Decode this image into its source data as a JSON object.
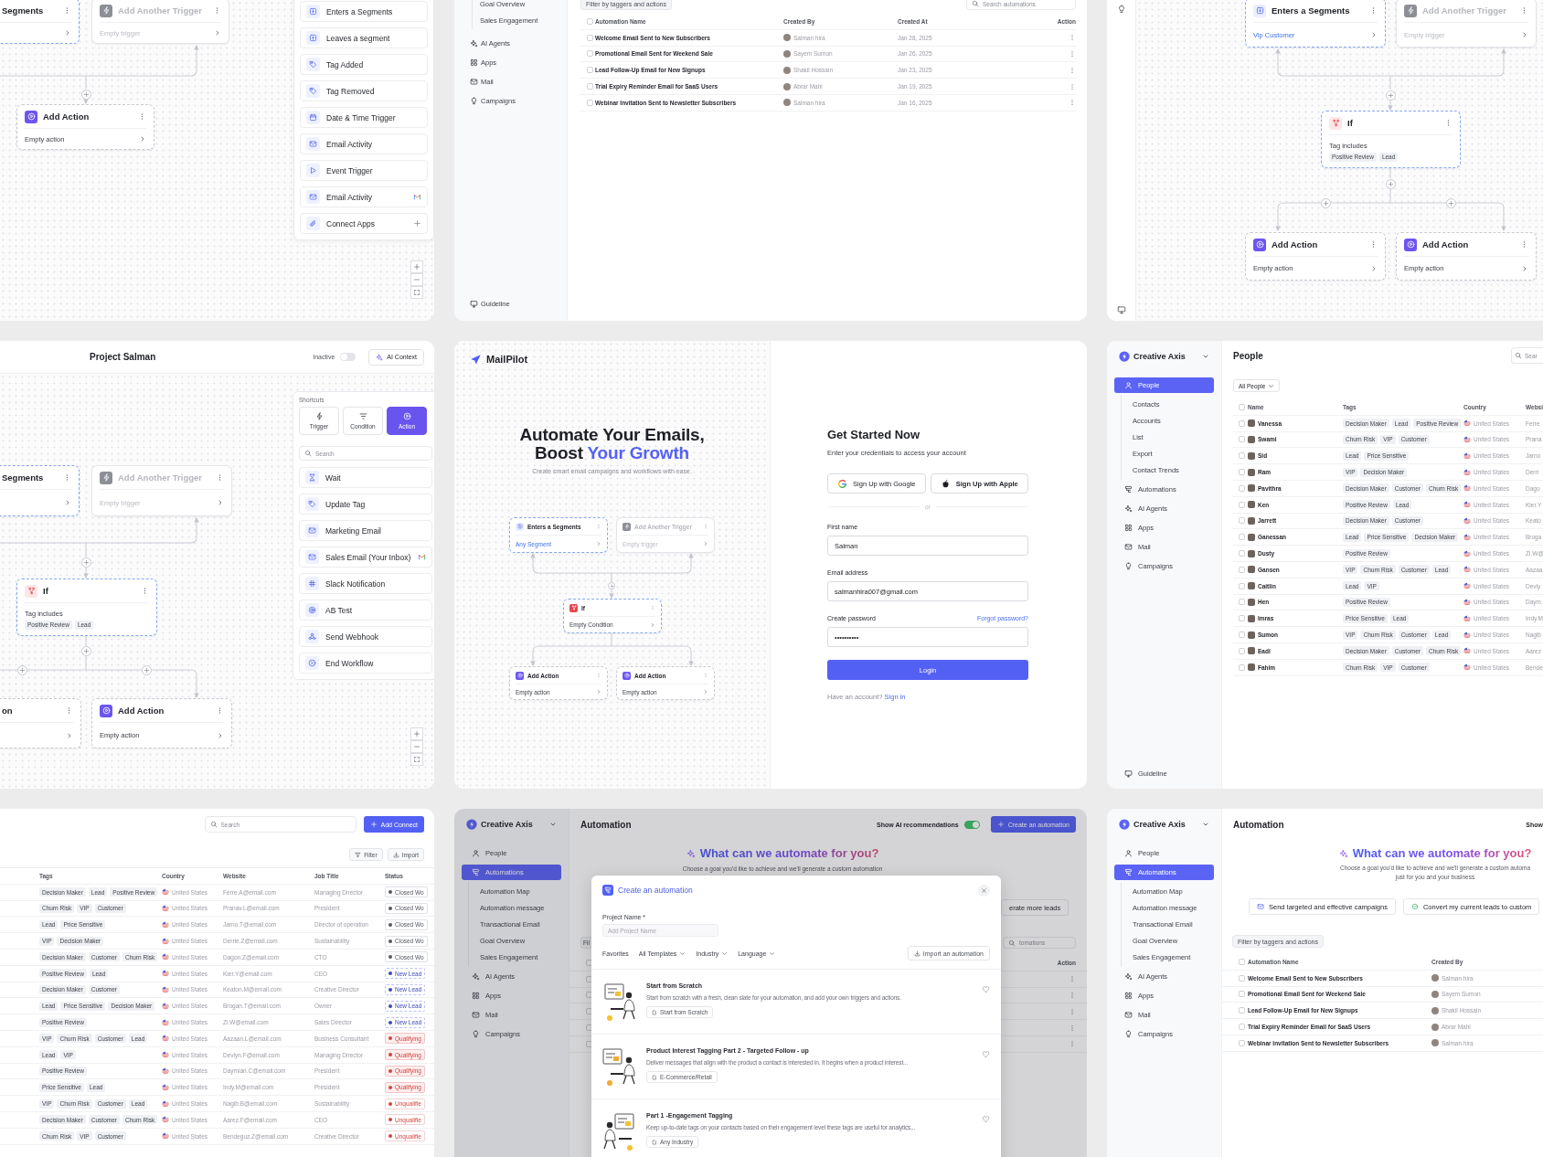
{
  "trigger_canvas": {
    "nodes": [
      {
        "kind": "trigger",
        "title": "Segments"
      },
      {
        "kind": "placeholder",
        "title": "Add Another Trigger",
        "subtitle": "Empty trigger"
      },
      {
        "kind": "action",
        "title": "Add Action",
        "subtitle": "Empty action"
      }
    ],
    "triggers": [
      "Enters a Segments",
      "Leaves a segment",
      "Tag Added",
      "Tag Removed",
      "Date & Time Trigger",
      "Email Activity",
      "Event Trigger",
      "Email Activity",
      "Connect Apps"
    ]
  },
  "automations_list": {
    "sidebar": [
      {
        "kind": "subitem",
        "label": "Goal Overview",
        "selected": false
      },
      {
        "kind": "subitem",
        "label": "Sales Engagement",
        "selected": false
      },
      {
        "kind": "item",
        "label": "AI Agents",
        "selected": false
      },
      {
        "kind": "item",
        "label": "Apps",
        "selected": false
      },
      {
        "kind": "item",
        "label": "Mail",
        "selected": false
      },
      {
        "kind": "item",
        "label": "Campaigns",
        "selected": false
      }
    ],
    "footer_link": "Guideline",
    "filter": "Filter by taggers and actions",
    "search": {
      "placeholder": "Search automations"
    },
    "select_all": false,
    "columns": [
      "Automation Name",
      "Created By",
      "Created At",
      "Action"
    ],
    "rows": [
      {
        "checked": false,
        "name": "Welcome Email Sent to New Subscribers",
        "created_by": "Salman hira",
        "created_at": "Jan 28, 2025"
      },
      {
        "checked": false,
        "name": "Promotional Email Sent for Weekend Sale",
        "created_by": "Sayem Sumon",
        "created_at": "Jan 26, 2025"
      },
      {
        "checked": false,
        "name": "Lead Follow-Up Email for New Signups",
        "created_by": "Shakil Hossain",
        "created_at": "Jan 23, 2025"
      },
      {
        "checked": false,
        "name": "Trial Expiry Reminder Email for SaaS Users",
        "created_by": "Abrar Mahi",
        "created_at": "Jan 19, 2025"
      },
      {
        "checked": false,
        "name": "Webinar Invitation Sent to Newsletter Subscribers",
        "created_by": "Salman hira",
        "created_at": "Jan 16, 2025"
      }
    ]
  },
  "condition_canvas": {
    "nodes": [
      {
        "kind": "trigger",
        "title": "Enters a Segments",
        "subtitle": "Vip Customer"
      },
      {
        "kind": "placeholder",
        "title": "Add Another Trigger",
        "subtitle": "Empty trigger"
      },
      {
        "kind": "condition",
        "title": "If",
        "subtitle": "Tag includes",
        "tags": [
          "Positive Review",
          "Lead"
        ]
      },
      {
        "kind": "action",
        "title": "Add Action",
        "subtitle": "Empty action"
      },
      {
        "kind": "action",
        "title": "Add Action",
        "subtitle": "Empty action"
      }
    ]
  },
  "workflow_editor": {
    "title": "Project Salman",
    "status_label": "Inactive",
    "active": false,
    "ai_button": "AI Context",
    "nodes": [
      {
        "kind": "trigger",
        "title": "Segments"
      },
      {
        "kind": "placeholder",
        "title": "Add Another Trigger",
        "subtitle": "Empty trigger"
      },
      {
        "kind": "condition",
        "title": "If",
        "subtitle": "Tag includes",
        "tags": [
          "Positive Review",
          "Lead"
        ]
      },
      {
        "kind": "action",
        "title": "on"
      },
      {
        "kind": "action",
        "title": "Add Action",
        "subtitle": "Empty action"
      }
    ],
    "shortcuts": {
      "heading": "Shortcuts",
      "tabs": [
        {
          "label": "Trigger",
          "selected": false
        },
        {
          "label": "Condition",
          "selected": false
        },
        {
          "label": "Action",
          "selected": true
        }
      ],
      "search": {
        "placeholder": "Search"
      },
      "items": [
        "Wait",
        "Update Tag",
        "Marketing Email",
        "Sales Email (Your Inbox)",
        "Slack Notification",
        "AB Test",
        "Send Webhook",
        "End Workflow"
      ]
    }
  },
  "sign_up": {
    "brand": "MailPilot",
    "headline_line1": "Automate Your Emails,",
    "headline_line2": "Boost",
    "headline_highlight": "Your Growth",
    "tagline": "Create smart email campaigns and workflows with ease.",
    "preview_nodes": [
      {
        "kind": "trigger",
        "title": "Enters a Segments",
        "subtitle": "Any Segment"
      },
      {
        "kind": "placeholder",
        "title": "Add Another Trigger",
        "subtitle": "Empty trigger"
      },
      {
        "kind": "condition",
        "title": "If",
        "subtitle": "Empty Condition"
      },
      {
        "kind": "action",
        "title": "Add Action",
        "subtitle": "Empty action"
      },
      {
        "kind": "action",
        "title": "Add Action",
        "subtitle": "Empty action"
      }
    ],
    "form": {
      "title": "Get Started Now",
      "subtitle": "Enter your credentials to access your account",
      "social": [
        {
          "kind": "google",
          "label": "Sign Up with Google"
        },
        {
          "kind": "apple",
          "label": "Sign Up with Apple"
        }
      ],
      "divider": "or",
      "fields": [
        {
          "label": "First name",
          "value": "Salman"
        },
        {
          "label": "Email address",
          "value": "salmanhira007@gmail.com"
        },
        {
          "label": "Create password",
          "value": "••••••••••",
          "link": "Forgot password?"
        }
      ],
      "submit": "Login",
      "footer": "Have an account?",
      "footer_link": "Sign in"
    }
  },
  "people": {
    "workspace": "Creative Axis",
    "nav": [
      {
        "label": "People",
        "selected": true,
        "children": [
          {
            "label": "Contacts",
            "selected": false
          },
          {
            "label": "Accounts",
            "selected": false
          },
          {
            "label": "List",
            "selected": false
          },
          {
            "label": "Export",
            "selected": false
          },
          {
            "label": "Contact Trends",
            "selected": false
          }
        ]
      },
      {
        "label": "Automations",
        "selected": false
      },
      {
        "label": "AI Agents",
        "selected": false
      },
      {
        "label": "Apps",
        "selected": false
      },
      {
        "label": "Mail",
        "selected": false
      },
      {
        "label": "Campaigns",
        "selected": false
      }
    ],
    "footer_link": "Guideline",
    "title": "People",
    "search": {
      "placeholder": "Sear"
    },
    "view_filter": "All People",
    "select_all": false,
    "columns": [
      "Name",
      "Tags",
      "Country",
      "Websi"
    ],
    "rows": [
      {
        "checked": false,
        "name": "Vanessa",
        "tags": [
          "Decision Maker",
          "Lead",
          "Positive Review"
        ],
        "country": "United States",
        "website": "Ferre"
      },
      {
        "checked": false,
        "name": "Swami",
        "tags": [
          "Churn Risk",
          "VIP",
          "Customer"
        ],
        "country": "United States",
        "website": "Prana"
      },
      {
        "checked": false,
        "name": "Sid",
        "tags": [
          "Lead",
          "Price Sensitive"
        ],
        "country": "United States",
        "website": "Jarno"
      },
      {
        "checked": false,
        "name": "Ram",
        "tags": [
          "VIP",
          "Decision Maker"
        ],
        "country": "United States",
        "website": "Derri"
      },
      {
        "checked": false,
        "name": "Pavithra",
        "tags": [
          "Decision Maker",
          "Customer",
          "Churn Risk"
        ],
        "country": "United States",
        "website": "Dago"
      },
      {
        "checked": false,
        "name": "Ken",
        "tags": [
          "Positive Review",
          "Lead"
        ],
        "country": "United States",
        "website": "Kier.Y"
      },
      {
        "checked": false,
        "name": "Jarrett",
        "tags": [
          "Decision Maker",
          "Customer"
        ],
        "country": "United States",
        "website": "Keato"
      },
      {
        "checked": false,
        "name": "Ganessan",
        "tags": [
          "Lead",
          "Price Sensitive",
          "Decision Maker"
        ],
        "country": "United States",
        "website": "Broga"
      },
      {
        "checked": false,
        "name": "Dusty",
        "tags": [
          "Positive Review"
        ],
        "country": "United States",
        "website": "Zi.W@"
      },
      {
        "checked": false,
        "name": "Gansen",
        "tags": [
          "VIP",
          "Churn Risk",
          "Customer",
          "Lead"
        ],
        "country": "United States",
        "website": "Aazaa"
      },
      {
        "checked": false,
        "name": "Caitlin",
        "tags": [
          "Lead",
          "VIP"
        ],
        "country": "United States",
        "website": "Devly"
      },
      {
        "checked": false,
        "name": "Hen",
        "tags": [
          "Positive Review"
        ],
        "country": "United States",
        "website": "Daym"
      },
      {
        "checked": false,
        "name": "Imras",
        "tags": [
          "Price Sensitive",
          "Lead"
        ],
        "country": "United States",
        "website": "Indy.M"
      },
      {
        "checked": false,
        "name": "Sumon",
        "tags": [
          "VIP",
          "Churn Risk",
          "Customer",
          "Lead"
        ],
        "country": "United States",
        "website": "Nagib"
      },
      {
        "checked": false,
        "name": "Eadi",
        "tags": [
          "Decision Maker",
          "Customer",
          "Churn Risk"
        ],
        "country": "United States",
        "website": "Aarez"
      },
      {
        "checked": false,
        "name": "Fahim",
        "tags": [
          "Churn Risk",
          "VIP",
          "Customer"
        ],
        "country": "United States",
        "website": "Bende"
      }
    ]
  },
  "contacts": {
    "search": {
      "placeholder": "Search"
    },
    "add_button": "Add Connect",
    "filter_button": "Filter",
    "import_button": "Import",
    "columns": [
      "Tags",
      "Country",
      "Website",
      "Job Title",
      "Status"
    ],
    "rows": [
      {
        "tags": [
          "Decision Maker",
          "Lead",
          "Positive Review"
        ],
        "country": "United States",
        "website": "Ferre.A@email.com",
        "job_title": "Managing Director",
        "status": {
          "kind": "closed",
          "label": "Closed Wo"
        }
      },
      {
        "tags": [
          "Churn Risk",
          "VIP",
          "Customer"
        ],
        "country": "United States",
        "website": "Pranav.L@email.com",
        "job_title": "President",
        "status": {
          "kind": "closed",
          "label": "Closed Wo"
        }
      },
      {
        "tags": [
          "Lead",
          "Price Sensitive"
        ],
        "country": "United States",
        "website": "Jarno.T@email.com",
        "job_title": "Director of operation",
        "status": {
          "kind": "closed",
          "label": "Closed Wo"
        }
      },
      {
        "tags": [
          "VIP",
          "Decision Maker"
        ],
        "country": "United States",
        "website": "Derrie.Z@email.com",
        "job_title": "Sustainability",
        "status": {
          "kind": "closed",
          "label": "Closed Wo"
        }
      },
      {
        "tags": [
          "Decision Maker",
          "Customer",
          "Churn Risk"
        ],
        "country": "United States",
        "website": "Dagon.Z@email.com",
        "job_title": "CTO",
        "status": {
          "kind": "closed",
          "label": "Closed Wo"
        }
      },
      {
        "tags": [
          "Positive Review",
          "Lead"
        ],
        "country": "United States",
        "website": "Kier.Y@email.com",
        "job_title": "CEO",
        "status": {
          "kind": "new",
          "label": "New Lead"
        }
      },
      {
        "tags": [
          "Decision Maker",
          "Customer"
        ],
        "country": "United States",
        "website": "Keaton.M@email.com",
        "job_title": "Creative Director",
        "status": {
          "kind": "new",
          "label": "New Lead"
        }
      },
      {
        "tags": [
          "Lead",
          "Price Sensitive",
          "Decision Maker"
        ],
        "country": "United States",
        "website": "Brogan.T@email.com",
        "job_title": "Owner",
        "status": {
          "kind": "new",
          "label": "New Lead"
        }
      },
      {
        "tags": [
          "Positive Review"
        ],
        "country": "United States",
        "website": "Zi.W@email.com",
        "job_title": "Sales Director",
        "status": {
          "kind": "new",
          "label": "New Lead"
        }
      },
      {
        "tags": [
          "VIP",
          "Churn Risk",
          "Customer",
          "Lead"
        ],
        "country": "United States",
        "website": "Aazaan.L@email.com",
        "job_title": "Business Consultant",
        "status": {
          "kind": "qualifying",
          "label": "Qualifying"
        }
      },
      {
        "tags": [
          "Lead",
          "VIP"
        ],
        "country": "United States",
        "website": "Devlyn.F@email.com",
        "job_title": "Managing Director",
        "status": {
          "kind": "qualifying",
          "label": "Qualifying"
        }
      },
      {
        "tags": [
          "Positive Review"
        ],
        "country": "United States",
        "website": "Daymian.C@email.com",
        "job_title": "President",
        "status": {
          "kind": "qualifying",
          "label": "Qualifying"
        }
      },
      {
        "tags": [
          "Price Sensitive",
          "Lead"
        ],
        "country": "United States",
        "website": "Indy.M@email.com",
        "job_title": "President",
        "status": {
          "kind": "qualifying",
          "label": "Qualifying"
        }
      },
      {
        "tags": [
          "VIP",
          "Churn Risk",
          "Customer",
          "Lead"
        ],
        "country": "United States",
        "website": "Nagib.B@email.com",
        "job_title": "Sustainability",
        "status": {
          "kind": "unqualified",
          "label": "Unqualifie"
        }
      },
      {
        "tags": [
          "Decision Maker",
          "Customer",
          "Churn Risk"
        ],
        "country": "United States",
        "website": "Aarez.F@email.com",
        "job_title": "CEO",
        "status": {
          "kind": "unqualified",
          "label": "Unqualifie"
        }
      },
      {
        "tags": [
          "Churn Risk",
          "VIP",
          "Customer"
        ],
        "country": "United States",
        "website": "Bendeguz.Z@email.com",
        "job_title": "Creative Director",
        "status": {
          "kind": "unqualified",
          "label": "Unqualifie"
        }
      }
    ]
  },
  "create_automation": {
    "workspace": "Creative Axis",
    "nav": [
      {
        "label": "People",
        "selected": false
      },
      {
        "label": "Automations",
        "selected": true,
        "children": [
          {
            "label": "Automation Map",
            "selected": false
          },
          {
            "label": "Automation message",
            "selected": false
          },
          {
            "label": "Transactional Email",
            "selected": false
          },
          {
            "label": "Goal Overview",
            "selected": false
          },
          {
            "label": "Sales Engagement",
            "selected": false
          }
        ]
      },
      {
        "label": "AI Agents",
        "selected": false
      },
      {
        "label": "Apps",
        "selected": false
      },
      {
        "label": "Mail",
        "selected": false
      },
      {
        "label": "Campaigns",
        "selected": false
      }
    ],
    "title": "Automation",
    "ai_toggle": {
      "label": "Show AI recommendations",
      "on": true
    },
    "create_button": "Create an automation",
    "heading": "What can we automate for you?",
    "subtitle": "Choose a goal you'd like to achieve and we'll generate a custom automation",
    "goal": "erate more leads",
    "filter": "Fil",
    "search": {
      "placeholder": "tomations"
    },
    "select_all": false,
    "action_column": "Action",
    "rows": [
      {
        "checked": false
      },
      {
        "checked": false
      },
      {
        "checked": false
      },
      {
        "checked": false
      },
      {
        "checked": false
      }
    ],
    "modal": {
      "title": "Create an automation",
      "field": {
        "label": "Project Name *",
        "placeholder": "Add Project Name"
      },
      "filters": [
        {
          "kind": "tab",
          "label": "Favorites"
        },
        {
          "kind": "dropdown",
          "label": "All Templates"
        },
        {
          "kind": "dropdown",
          "label": "Industry"
        },
        {
          "kind": "dropdown",
          "label": "Language"
        }
      ],
      "import_button": "Import an automation",
      "templates": [
        {
          "title": "Start from Scratch",
          "description": "Start from scratch with a fresh, clean slate for your automation, and add your own triggers and actions.",
          "tag": "Start from Scratch",
          "favorite": false
        },
        {
          "title": "Product Interest Tagging Part 2 - Targeted Follow - up",
          "description": "Deliver messages that align with the product a contact is interested in. It begins when a product interest...",
          "tag": "E-Commerce/Retail",
          "favorite": false
        },
        {
          "title": "Part 1 -Engagement Tagging",
          "description": "Keep up-to-date tags on your contacts based on their engagement level these tags are useful for analytics...",
          "tag": "Any Industry",
          "favorite": false
        }
      ]
    }
  },
  "automation_home": {
    "workspace": "Creative Axis",
    "nav": [
      {
        "label": "People",
        "selected": false
      },
      {
        "label": "Automations",
        "selected": true,
        "children": [
          {
            "label": "Automation Map",
            "selected": false
          },
          {
            "label": "Automation message",
            "selected": false
          },
          {
            "label": "Transactional Email",
            "selected": false
          },
          {
            "label": "Goal Overview",
            "selected": false
          },
          {
            "label": "Sales Engagement",
            "selected": false
          }
        ]
      },
      {
        "label": "AI Agents",
        "selected": false
      },
      {
        "label": "Apps",
        "selected": false
      },
      {
        "label": "Mail",
        "selected": false
      },
      {
        "label": "Campaigns",
        "selected": false
      }
    ],
    "title": "Automation",
    "ai_toggle_label": "Show",
    "heading": "What can we automate for you?",
    "subtitle_lines": [
      "Choose a goal you'd like to achieve and we'll generate a custom automa",
      "just for you and your business"
    ],
    "goals": [
      {
        "kind": "mail",
        "label": "Send targeted and effective campaigns"
      },
      {
        "kind": "check",
        "label": "Convert my current leads to custom"
      }
    ],
    "filter": "Filter by taggers and actions",
    "select_all": false,
    "columns": [
      "Automation Name",
      "Created By"
    ],
    "rows": [
      {
        "checked": false,
        "name": "Welcome Email Sent to New Subscribers",
        "created_by": "Salman hira"
      },
      {
        "checked": false,
        "name": "Promotional Email Sent for Weekend Sale",
        "created_by": "Sayem Sumon"
      },
      {
        "checked": false,
        "name": "Lead Follow-Up Email for New Signups",
        "created_by": "Shakil Hossain"
      },
      {
        "checked": false,
        "name": "Trial Expiry Reminder Email for SaaS Users",
        "created_by": "Abrar Mahi"
      },
      {
        "checked": false,
        "name": "Webinar Invitation Sent to Newsletter Subscribers",
        "created_by": "Salman hira"
      }
    ]
  }
}
